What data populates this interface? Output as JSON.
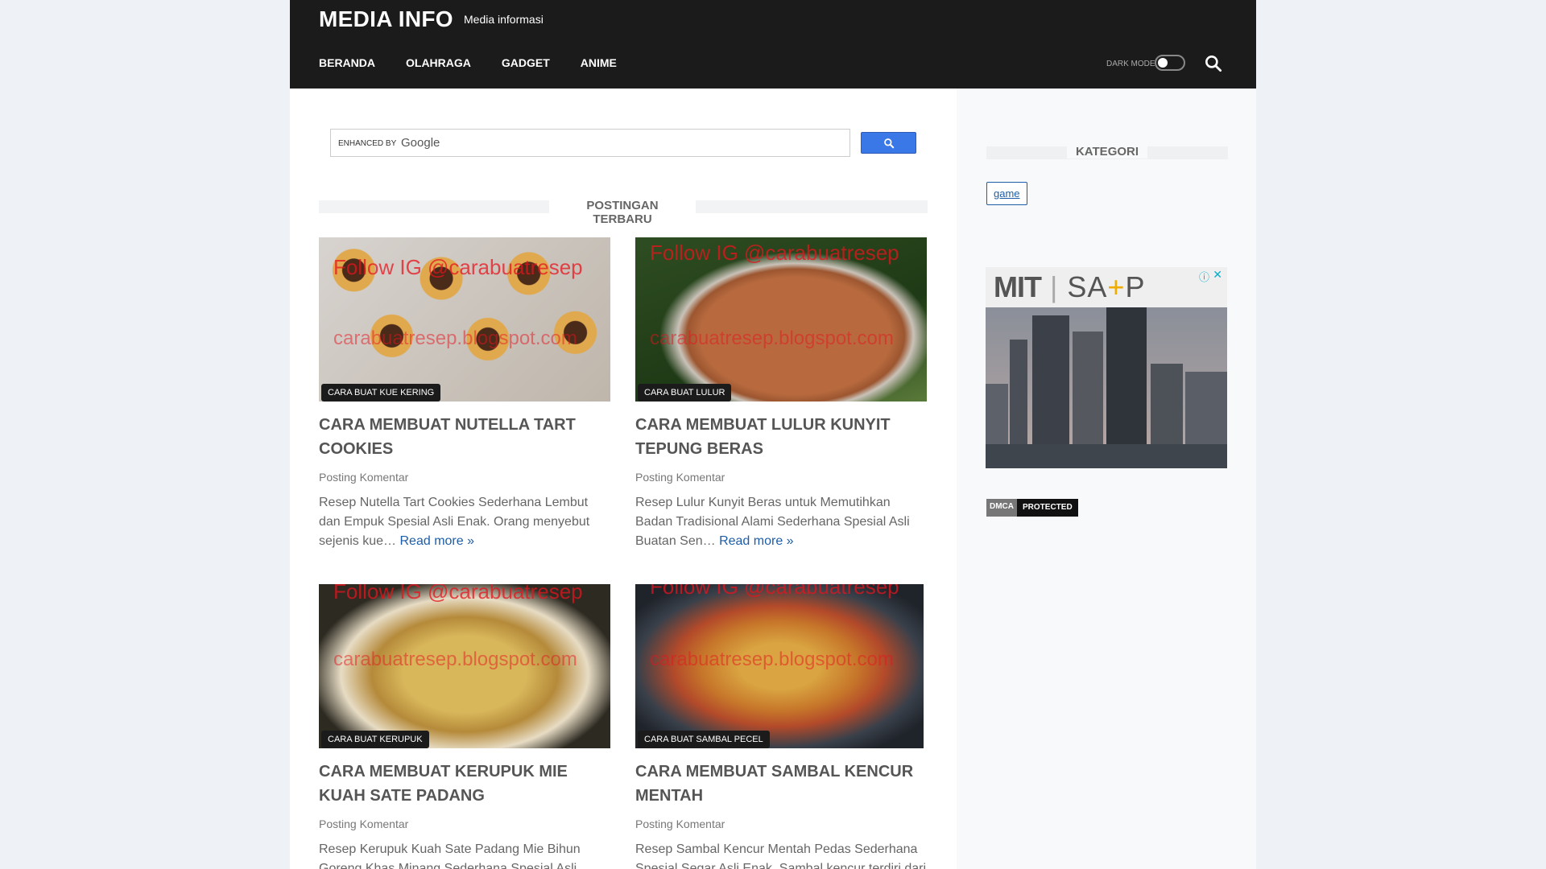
{
  "header": {
    "site_title": "MEDIA INFO",
    "site_description": "Media informasi",
    "nav": [
      "BERANDA",
      "OLAHRAGA",
      "GADGET",
      "ANIME"
    ],
    "dark_mode_label": "DARK MODE"
  },
  "search": {
    "enhanced_by": "ENHANCED BY",
    "google": "Google"
  },
  "main": {
    "section_title": "POSTINGAN TERBARU",
    "posts": [
      {
        "badge": "CARA BUAT KUE KERING",
        "title": "CARA MEMBUAT NUTELLA TART COOKIES",
        "meta": "Posting Komentar",
        "excerpt": "Resep Nutella Tart Cookies Sederhana Lembut dan Empuk Spesial Asli Enak. Orang menyebut sejenis kue…",
        "read_more": "Read more »",
        "watermark_top": "Follow IG @carabuatresep",
        "watermark_mid": "carabuatresep.blogspot.com"
      },
      {
        "badge": "CARA BUAT LULUR",
        "title": "CARA MEMBUAT LULUR KUNYIT TEPUNG BERAS",
        "meta": "Posting Komentar",
        "excerpt": "Resep Lulur Kunyit Beras untuk Memutihkan Badan Tradisional Alami Sederhana Spesial Asli Buatan Sen…",
        "read_more": "Read more »",
        "watermark_top": "Follow IG @carabuatresep",
        "watermark_mid": "carabuatresep.blogspot.com"
      },
      {
        "badge": "CARA BUAT KERUPUK",
        "title": "CARA MEMBUAT KERUPUK MIE KUAH SATE PADANG",
        "meta": "Posting Komentar",
        "excerpt": "Resep Kerupuk Kuah Sate Padang Mie Bihun Goreng Khas Minang Sederhana Spesial Asli Enak.",
        "read_more": "",
        "watermark_top": "Follow IG @carabuatresep",
        "watermark_mid": "carabuatresep.blogspot.com"
      },
      {
        "badge": "CARA BUAT SAMBAL PECEL",
        "title": "CARA MEMBUAT SAMBAL KENCUR MENTAH",
        "meta": "Posting Komentar",
        "excerpt": "Resep Sambal Kencur Mentah Pedas Sederhana Spesial Segar Asli Enak. Sambal kencur terdiri dari",
        "read_more": "",
        "watermark_top": "Follow IG @carabuatresep",
        "watermark_mid": "carabuatresep.blogspot.com"
      }
    ]
  },
  "sidebar": {
    "section_title": "KATEGORI",
    "tags": [
      "game"
    ],
    "ad": {
      "logo_left": "MIT",
      "logo_right_a": "SA",
      "logo_plus": "+",
      "logo_right_b": "P",
      "info": "ⓘ",
      "close": "✕"
    },
    "dmca": {
      "left": "DMCA",
      "right": "PROTECTED"
    }
  },
  "colors": {
    "header_bg": "#1b1b1b",
    "link": "#1d5da8",
    "google_button": "#3b78e7"
  },
  "icons": [
    "search-icon",
    "toggle-switch",
    "google-search-icon"
  ]
}
